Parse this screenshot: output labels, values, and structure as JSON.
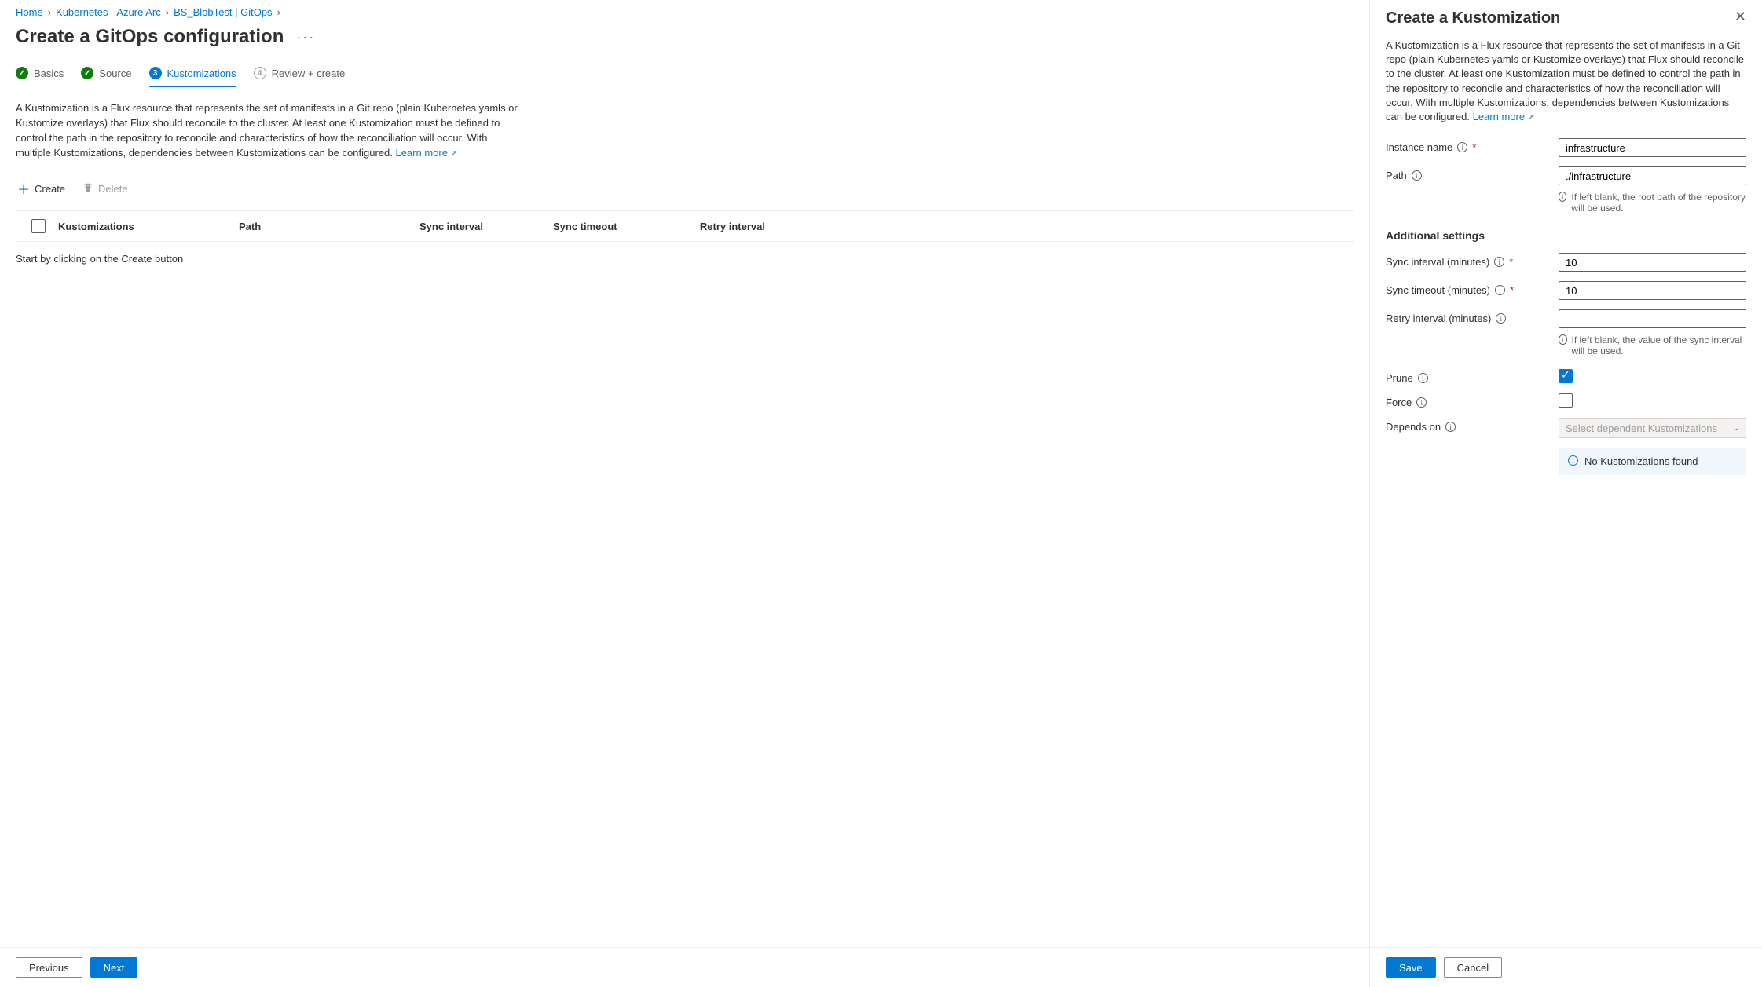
{
  "breadcrumb": {
    "items": [
      "Home",
      "Kubernetes - Azure Arc",
      "BS_BlobTest | GitOps"
    ]
  },
  "page": {
    "title": "Create a GitOps configuration"
  },
  "tabs": {
    "basics": "Basics",
    "source": "Source",
    "kustomizations": "Kustomizations",
    "review": "Review + create",
    "step3": "3",
    "step4": "4"
  },
  "main": {
    "description": "A Kustomization is a Flux resource that represents the set of manifests in a Git repo (plain Kubernetes yamls or Kustomize overlays) that Flux should reconcile to the cluster. At least one Kustomization must be defined to control the path in the repository to reconcile and characteristics of how the reconciliation will occur. With multiple Kustomizations, dependencies between Kustomizations can be configured.",
    "learn_more": "Learn more",
    "create_btn": "Create",
    "delete_btn": "Delete",
    "columns": {
      "kustomizations": "Kustomizations",
      "path": "Path",
      "sync_interval": "Sync interval",
      "sync_timeout": "Sync timeout",
      "retry_interval": "Retry interval"
    },
    "empty": "Start by clicking on the Create button",
    "previous": "Previous",
    "next": "Next"
  },
  "panel": {
    "title": "Create a Kustomization",
    "description": "A Kustomization is a Flux resource that represents the set of manifests in a Git repo (plain Kubernetes yamls or Kustomize overlays) that Flux should reconcile to the cluster. At least one Kustomization must be defined to control the path in the repository to reconcile and characteristics of how the reconciliation will occur. With multiple Kustomizations, dependencies between Kustomizations can be configured.",
    "learn_more": "Learn more",
    "labels": {
      "instance_name": "Instance name",
      "path": "Path",
      "sync_interval": "Sync interval (minutes)",
      "sync_timeout": "Sync timeout (minutes)",
      "retry_interval": "Retry interval (minutes)",
      "prune": "Prune",
      "force": "Force",
      "depends_on": "Depends on"
    },
    "values": {
      "instance_name": "infrastructure",
      "path": "./infrastructure",
      "sync_interval": "10",
      "sync_timeout": "10",
      "retry_interval": ""
    },
    "help": {
      "path": "If left blank, the root path of the repository will be used.",
      "retry": "If left blank, the value of the sync interval will be used."
    },
    "section": "Additional settings",
    "depends_placeholder": "Select dependent Kustomizations",
    "banner": "No Kustomizations found",
    "save": "Save",
    "cancel": "Cancel"
  }
}
